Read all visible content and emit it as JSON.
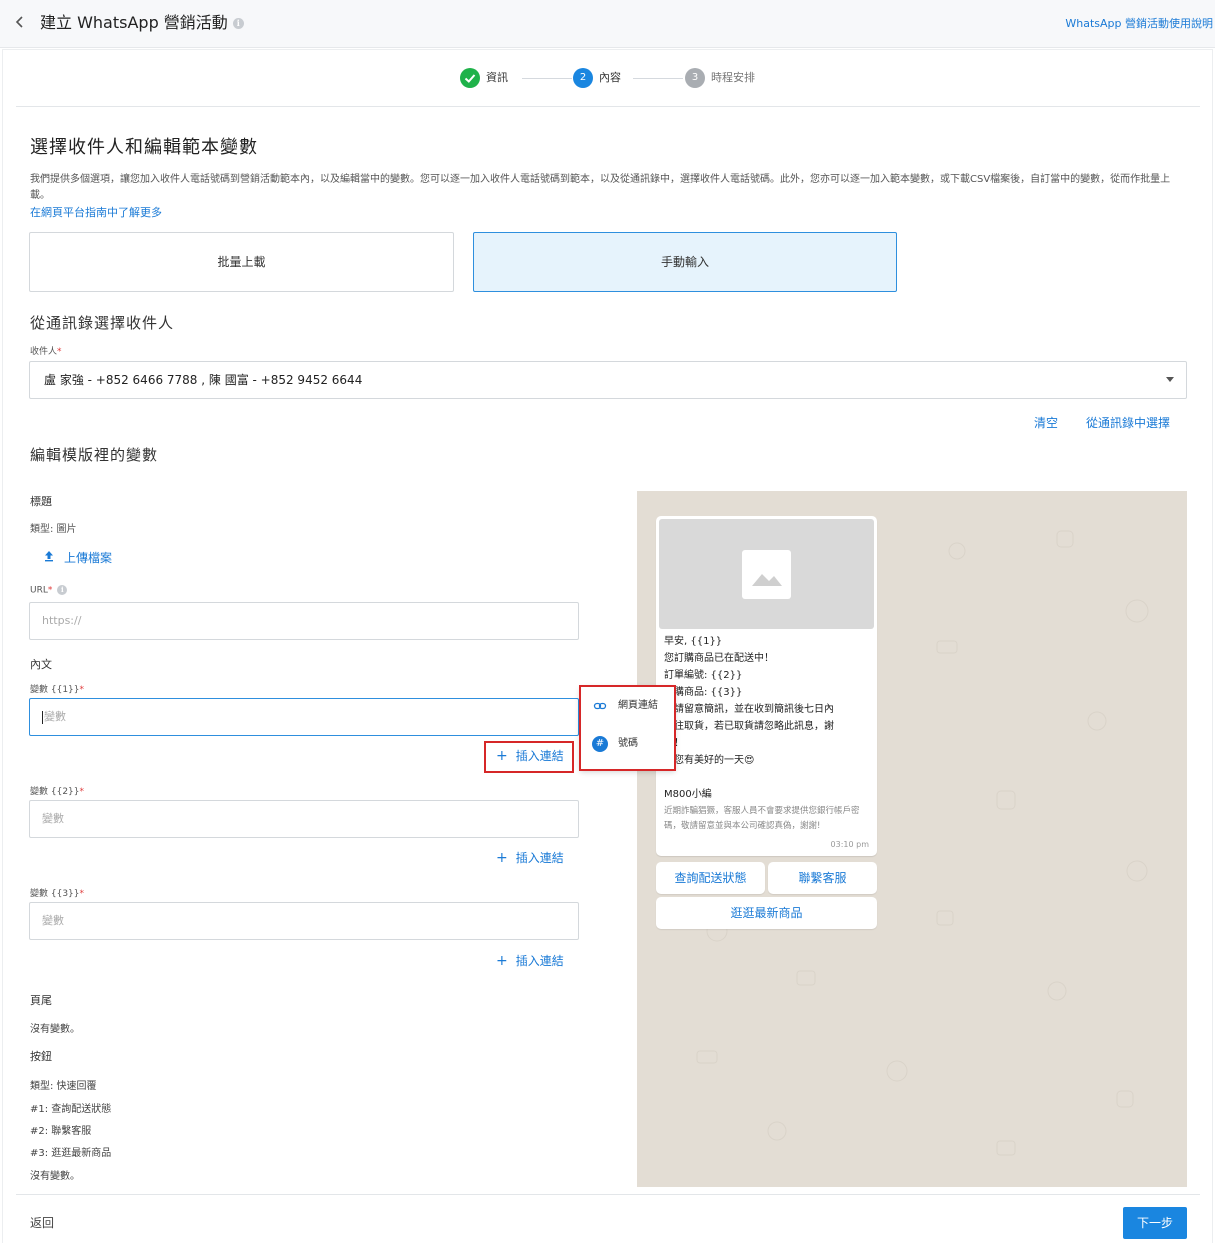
{
  "header": {
    "title": "建立 WhatsApp 營銷活動",
    "help_link": "WhatsApp 營銷活動使用說明"
  },
  "stepper": {
    "steps": [
      {
        "number": "",
        "label": "資訊",
        "status": "done"
      },
      {
        "number": "2",
        "label": "內容",
        "status": "active"
      },
      {
        "number": "3",
        "label": "時程安排",
        "status": "pending"
      }
    ]
  },
  "recipients_section": {
    "title": "選擇收件人和編輯範本變數",
    "description": "我們提供多個選項，讓您加入收件人電話號碼到營銷活動範本內，以及編輯當中的變數。您可以逐一加入收件人電話號碼到範本，以及從通訊錄中，選擇收件人電話號碼。此外，您亦可以逐一加入範本變數，或下載CSV檔案後，自訂當中的變數，從而作批量上載。",
    "learn_more": "在網頁平台指南中了解更多",
    "mode_bulk": "批量上載",
    "mode_manual": "手動輸入"
  },
  "contacts_section": {
    "title": "從通訊錄選擇收件人",
    "recipient_label": "收件人",
    "required_mark": "*",
    "recipient_value": "盧 家強 - +852 6466 7788 , 陳 國富 - +852 9452 6644",
    "clear": "清空",
    "choose_from_contacts": "從通訊錄中選擇"
  },
  "variables_section": {
    "title": "編輯模版裡的變數",
    "header_label": "標題",
    "header_type": "類型: 圖片",
    "upload": "上傳檔案",
    "url_label": "URL",
    "url_placeholder": "https://",
    "body_label": "內文",
    "var1_label": "變數 {{1}}",
    "var2_label": "變數 {{2}}",
    "var3_label": "變數 {{3}}",
    "var_placeholder": "變數",
    "insert_link": "插入連結",
    "footer_label": "頁尾",
    "footer_value": "沒有變數。",
    "buttons_label": "按鈕",
    "buttons_type": "類型: 快速回覆",
    "button_1": "#1: 查詢配送狀態",
    "button_2": "#2: 聯繫客服",
    "button_3": "#3: 逛逛最新商品",
    "buttons_value": "沒有變數。"
  },
  "insert_menu": {
    "item_url": "網頁連結",
    "item_number": "號碼"
  },
  "preview": {
    "lines": [
      "早安, {{1}}",
      "您訂購商品已在配送中！",
      "訂單編號: {{2}}",
      "訂購商品: {{3}}",
      "敬請留意簡訊，並在收到簡訊後七日內",
      "前往取貨，若已取貨請忽略此訊息，謝",
      "謝！",
      "祝您有美好的一天😍"
    ],
    "sender": "M800小編",
    "footer_note": "近期詐騙猖獗，客服人員不會要求提供您銀行帳戶密碼，敬請留意並與本公司確認真偽，謝謝!",
    "time": "03:10 pm",
    "btn_track": "查詢配送狀態",
    "btn_contact": "聯繫客服",
    "btn_shop": "逛逛最新商品"
  },
  "footer": {
    "back": "返回",
    "next": "下一步"
  },
  "colors": {
    "accent": "#1a7ad6",
    "primary_button": "#1a86e0",
    "success": "#1fb24a",
    "highlight": "#d62728",
    "preview_bg": "#e3ddd4"
  }
}
